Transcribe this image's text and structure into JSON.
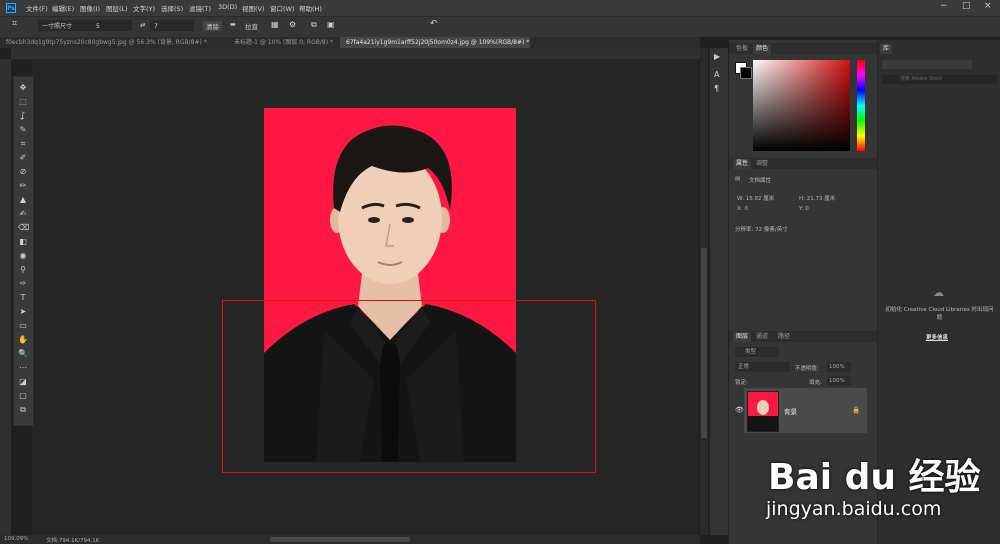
{
  "app": {
    "logo": "Ps"
  },
  "menu": [
    "文件(F)",
    "编辑(E)",
    "图像(I)",
    "图层(L)",
    "文字(Y)",
    "选择(S)",
    "滤镜(T)",
    "3D(D)",
    "视图(V)",
    "窗口(W)",
    "帮助(H)"
  ],
  "window_controls": [
    "−",
    "□",
    "×"
  ],
  "options": {
    "crop_icon": "crop-icon",
    "preset": "一寸照尺寸",
    "width": "5",
    "swap": "⇄",
    "height": "7",
    "clear": "清除",
    "straighten": "拉直",
    "grid": "▦",
    "gear": "⚙",
    "undo": "↶"
  },
  "tabs": [
    {
      "label": "f0ecbh3dq1g9tp75yzns20c80gbwg5.jpg @ 56.3% (背景, RGB/8#) *"
    },
    {
      "label": "未标题-1 @ 10% (图层 0, RGB/8) *"
    },
    {
      "label": "67fa4a21iy1g9m1arff52j20j50om0z4.jpg @ 109%(RGB/8#) *"
    }
  ],
  "tools": [
    "✥",
    "⬚",
    "ʆ",
    "✎",
    "⌗",
    "✐",
    "⊘",
    "✏",
    "▲",
    "✍",
    "⌫",
    "◧",
    "◉",
    "⚲",
    "✑",
    "T",
    "➤",
    "▭",
    "✋",
    "🔍",
    "⋯",
    "◪",
    "▢",
    "⧉"
  ],
  "status": {
    "zoom": "109.09%",
    "doc": "文档:794.1K/794.1K"
  },
  "mini_icons": [
    "▶",
    "A",
    "¶"
  ],
  "color_panel": {
    "tabs": [
      "色板",
      "颜色"
    ]
  },
  "props_panel": {
    "tabs": [
      "属性",
      "调整"
    ],
    "title": "文档属性",
    "w": "W: 15.92 厘米",
    "h": "H: 21.73 厘米",
    "x": "X: 0",
    "y": "Y: 0",
    "resolution": "分辨率: 72 像素/英寸"
  },
  "layers_panel": {
    "tabs": [
      "图层",
      "通道",
      "路径"
    ],
    "kind": "类型",
    "mode": "正常",
    "opacity_label": "不透明度:",
    "opacity": "100%",
    "lock_label": "锁定:",
    "fill_label": "填充:",
    "fill": "100%",
    "layer_name": "背景"
  },
  "libraries": {
    "tab": "库",
    "search": "搜索 Adobe Stock",
    "message": "初始化 Creative Cloud Libraries 时出现问题",
    "more": "更多信息"
  },
  "watermark": {
    "brand": "Bai du 经验",
    "url": "jingyan.baidu.com"
  }
}
